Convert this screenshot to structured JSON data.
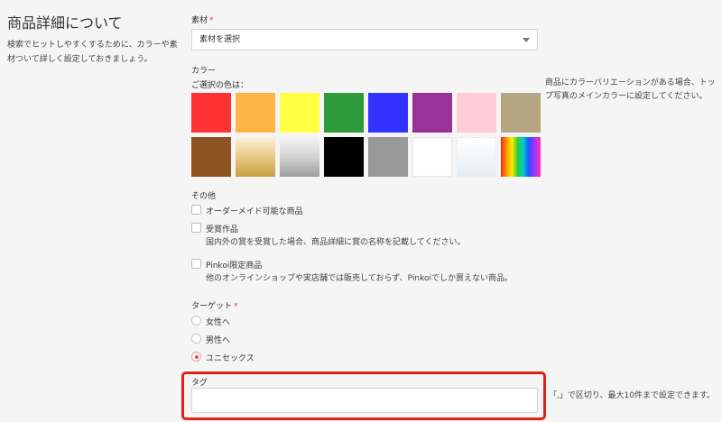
{
  "section": {
    "title": "商品詳細について",
    "description": "検索でヒットしやすくするために、カラーや素材ついて詳しく設定しておきましょう。"
  },
  "material": {
    "label": "素材",
    "required_mark": "*",
    "selected": "素材を選択"
  },
  "color": {
    "label": "カラー",
    "selected_label": "ご選択の色は：",
    "hint": "商品にカラーバリエーションがある場合、トップ写真のメインカラーに設定してください。",
    "swatches": [
      {
        "name": "red",
        "hex": "#ff3333"
      },
      {
        "name": "orange",
        "hex": "#ffb444"
      },
      {
        "name": "yellow",
        "hex": "#ffff44"
      },
      {
        "name": "green",
        "hex": "#2d9a3c"
      },
      {
        "name": "blue",
        "hex": "#3333ff"
      },
      {
        "name": "purple",
        "hex": "#993399"
      },
      {
        "name": "pink",
        "hex": "#ffccd6"
      },
      {
        "name": "beige",
        "hex": "#b5a582"
      },
      {
        "name": "brown",
        "hex": "#8b5420"
      },
      {
        "name": "gold",
        "hex": "gradient"
      },
      {
        "name": "silver",
        "hex": "gradient"
      },
      {
        "name": "black",
        "hex": "#000000"
      },
      {
        "name": "gray",
        "hex": "#999999"
      },
      {
        "name": "white",
        "hex": "#ffffff"
      },
      {
        "name": "clear",
        "hex": "gradient"
      },
      {
        "name": "multicolor",
        "hex": "gradient"
      }
    ]
  },
  "other": {
    "label": "その他",
    "options": [
      {
        "label": "オーダーメイド可能な商品",
        "hint": "",
        "checked": false
      },
      {
        "label": "受賞作品",
        "hint": "国内外の賞を受賞した場合、商品詳細に賞の名称を記載してください。",
        "checked": false
      },
      {
        "label": "Pinkoi限定商品",
        "hint": "他のオンラインショップや実店舗では販売しておらず、Pinkoiでしか買えない商品。",
        "checked": false
      }
    ]
  },
  "target": {
    "label": "ターゲット",
    "required_mark": "*",
    "options": [
      {
        "label": "女性へ",
        "checked": false
      },
      {
        "label": "男性へ",
        "checked": false
      },
      {
        "label": "ユニセックス",
        "checked": true
      }
    ]
  },
  "tag": {
    "label": "タグ",
    "value": "",
    "hint": "「,」で区切り、最大10件まで設定できます。"
  },
  "colors": {
    "accent": "#e0201a",
    "radio_selected": "#e04a3a"
  }
}
